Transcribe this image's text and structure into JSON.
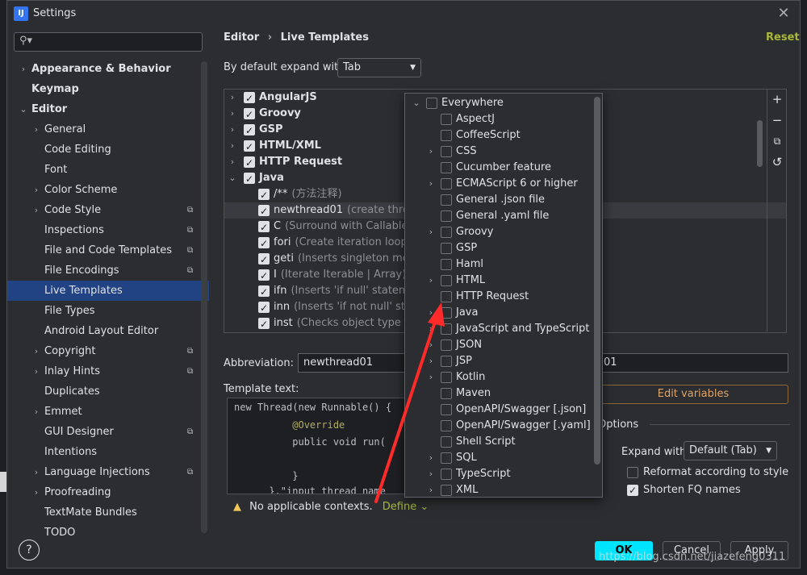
{
  "window": {
    "title": "Settings",
    "app_icon": "IJ"
  },
  "search": {
    "placeholder": "",
    "icon": "search-icon"
  },
  "sidebar": {
    "items": [
      {
        "label": "Appearance & Behavior",
        "level": 0,
        "arrow": "›",
        "bold": true,
        "proj": ""
      },
      {
        "label": "Keymap",
        "level": 0,
        "arrow": "",
        "bold": true,
        "proj": ""
      },
      {
        "label": "Editor",
        "level": 0,
        "arrow": "⌄",
        "bold": true,
        "proj": ""
      },
      {
        "label": "General",
        "level": 1,
        "arrow": "›",
        "bold": false,
        "proj": ""
      },
      {
        "label": "Code Editing",
        "level": 1,
        "arrow": "",
        "bold": false,
        "proj": ""
      },
      {
        "label": "Font",
        "level": 1,
        "arrow": "",
        "bold": false,
        "proj": ""
      },
      {
        "label": "Color Scheme",
        "level": 1,
        "arrow": "›",
        "bold": false,
        "proj": ""
      },
      {
        "label": "Code Style",
        "level": 1,
        "arrow": "›",
        "bold": false,
        "proj": "⧉"
      },
      {
        "label": "Inspections",
        "level": 1,
        "arrow": "",
        "bold": false,
        "proj": "⧉"
      },
      {
        "label": "File and Code Templates",
        "level": 1,
        "arrow": "",
        "bold": false,
        "proj": "⧉"
      },
      {
        "label": "File Encodings",
        "level": 1,
        "arrow": "",
        "bold": false,
        "proj": "⧉"
      },
      {
        "label": "Live Templates",
        "level": 1,
        "arrow": "",
        "bold": false,
        "proj": "",
        "selected": true
      },
      {
        "label": "File Types",
        "level": 1,
        "arrow": "",
        "bold": false,
        "proj": ""
      },
      {
        "label": "Android Layout Editor",
        "level": 1,
        "arrow": "",
        "bold": false,
        "proj": ""
      },
      {
        "label": "Copyright",
        "level": 1,
        "arrow": "›",
        "bold": false,
        "proj": "⧉"
      },
      {
        "label": "Inlay Hints",
        "level": 1,
        "arrow": "›",
        "bold": false,
        "proj": "⧉"
      },
      {
        "label": "Duplicates",
        "level": 1,
        "arrow": "",
        "bold": false,
        "proj": ""
      },
      {
        "label": "Emmet",
        "level": 1,
        "arrow": "›",
        "bold": false,
        "proj": ""
      },
      {
        "label": "GUI Designer",
        "level": 1,
        "arrow": "",
        "bold": false,
        "proj": "⧉"
      },
      {
        "label": "Intentions",
        "level": 1,
        "arrow": "",
        "bold": false,
        "proj": ""
      },
      {
        "label": "Language Injections",
        "level": 1,
        "arrow": "›",
        "bold": false,
        "proj": "⧉"
      },
      {
        "label": "Proofreading",
        "level": 1,
        "arrow": "›",
        "bold": false,
        "proj": ""
      },
      {
        "label": "TextMate Bundles",
        "level": 1,
        "arrow": "",
        "bold": false,
        "proj": ""
      },
      {
        "label": "TODO",
        "level": 1,
        "arrow": "",
        "bold": false,
        "proj": ""
      }
    ]
  },
  "header": {
    "breadcrumb_parent": "Editor",
    "breadcrumb_sep": "›",
    "breadcrumb_current": "Live Templates",
    "reset": "Reset"
  },
  "expand": {
    "label": "By default expand with",
    "value": "Tab"
  },
  "templates": [
    {
      "kind": "group",
      "arrow": "›",
      "checked": true,
      "name": "AngularJS",
      "desc": ""
    },
    {
      "kind": "group",
      "arrow": "›",
      "checked": true,
      "name": "Groovy",
      "desc": ""
    },
    {
      "kind": "group",
      "arrow": "›",
      "checked": true,
      "name": "GSP",
      "desc": ""
    },
    {
      "kind": "group",
      "arrow": "›",
      "checked": true,
      "name": "HTML/XML",
      "desc": ""
    },
    {
      "kind": "group",
      "arrow": "›",
      "checked": true,
      "name": "HTTP Request",
      "desc": ""
    },
    {
      "kind": "group",
      "arrow": "⌄",
      "checked": true,
      "name": "Java",
      "desc": ""
    },
    {
      "kind": "item",
      "arrow": "",
      "checked": true,
      "name": "/**",
      "desc": "(方法注释)"
    },
    {
      "kind": "item",
      "arrow": "",
      "checked": true,
      "name": "newthread01",
      "desc": "(create thread",
      "selected": true
    },
    {
      "kind": "item",
      "arrow": "",
      "checked": true,
      "name": "C",
      "desc": "(Surround with Callable)"
    },
    {
      "kind": "item",
      "arrow": "",
      "checked": true,
      "name": "fori",
      "desc": "(Create iteration loop)"
    },
    {
      "kind": "item",
      "arrow": "",
      "checked": true,
      "name": "geti",
      "desc": "(Inserts singleton metho"
    },
    {
      "kind": "item",
      "arrow": "",
      "checked": true,
      "name": "I",
      "desc": "(Iterate Iterable | Array)"
    },
    {
      "kind": "item",
      "arrow": "",
      "checked": true,
      "name": "ifn",
      "desc": "(Inserts 'if null' statement"
    },
    {
      "kind": "item",
      "arrow": "",
      "checked": true,
      "name": "inn",
      "desc": "(Inserts 'if not null' stater"
    },
    {
      "kind": "item",
      "arrow": "",
      "checked": true,
      "name": "inst",
      "desc": "(Checks object type with"
    }
  ],
  "toolbar": {
    "add": "+",
    "remove": "−",
    "copy": "⧉",
    "restore": "↺"
  },
  "abbreviation": {
    "label": "Abbreviation:",
    "value": "newthread01",
    "description_value": "01"
  },
  "template_text": {
    "label": "Template text:",
    "lines": [
      "new Thread(new Runnable() {",
      "          @Override",
      "          public void run(",
      "",
      "          }",
      "      }.\"input thread name"
    ]
  },
  "edit_variables": "Edit variables",
  "options": {
    "label": "Options",
    "expand_with_label": "Expand with",
    "expand_with_value": "Default (Tab)",
    "reformat_label": "Reformat according to style",
    "reformat_checked": false,
    "shorten_label": "Shorten FQ names",
    "shorten_checked": true
  },
  "warning": {
    "text": "No applicable contexts.",
    "define": "Define ⌄"
  },
  "contexts": [
    {
      "label": "Everywhere",
      "arrow": "⌄",
      "top": true
    },
    {
      "label": "AspectJ",
      "arrow": ""
    },
    {
      "label": "CoffeeScript",
      "arrow": ""
    },
    {
      "label": "CSS",
      "arrow": "›"
    },
    {
      "label": "Cucumber feature",
      "arrow": ""
    },
    {
      "label": "ECMAScript 6 or higher",
      "arrow": "›"
    },
    {
      "label": "General .json file",
      "arrow": ""
    },
    {
      "label": "General .yaml file",
      "arrow": ""
    },
    {
      "label": "Groovy",
      "arrow": "›"
    },
    {
      "label": "GSP",
      "arrow": ""
    },
    {
      "label": "Haml",
      "arrow": ""
    },
    {
      "label": "HTML",
      "arrow": "›"
    },
    {
      "label": "HTTP Request",
      "arrow": ""
    },
    {
      "label": "Java",
      "arrow": "›"
    },
    {
      "label": "JavaScript and TypeScript",
      "arrow": "›"
    },
    {
      "label": "JSON",
      "arrow": "›"
    },
    {
      "label": "JSP",
      "arrow": "›"
    },
    {
      "label": "Kotlin",
      "arrow": "›"
    },
    {
      "label": "Maven",
      "arrow": ""
    },
    {
      "label": "OpenAPI/Swagger [.json]",
      "arrow": ""
    },
    {
      "label": "OpenAPI/Swagger [.yaml]",
      "arrow": ""
    },
    {
      "label": "Shell Script",
      "arrow": ""
    },
    {
      "label": "SQL",
      "arrow": "›"
    },
    {
      "label": "TypeScript",
      "arrow": "›"
    },
    {
      "label": "XML",
      "arrow": "›"
    }
  ],
  "footer": {
    "help": "?",
    "ok": "OK",
    "cancel": "Cancel",
    "apply": "Apply"
  },
  "watermark": "https://blog.csdn.net/jiazefeng0311",
  "colors": {
    "accent_link": "#a9b837",
    "ok_button": "#00e5ff",
    "selection": "#214283",
    "annotation_arrow": "#ff2a2a"
  }
}
